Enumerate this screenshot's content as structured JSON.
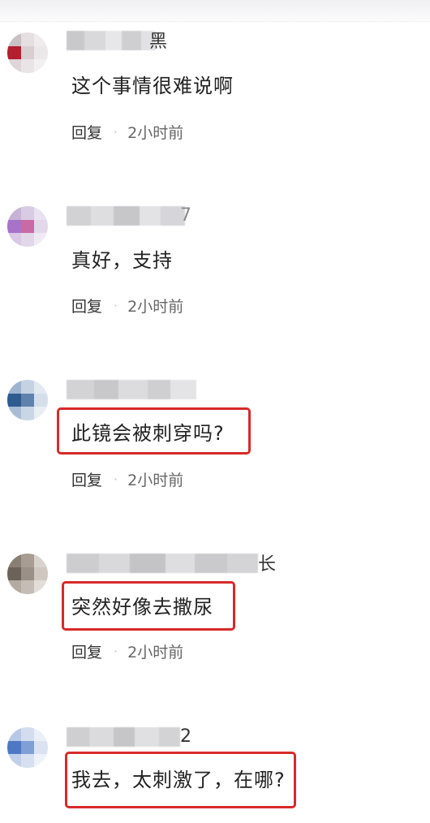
{
  "comments": [
    {
      "name_tail": "黑",
      "text": "这个事情很难说啊",
      "reply": "回复",
      "dot": "·",
      "time": "2小时前"
    },
    {
      "name_tail": "7",
      "text": "真好，支持",
      "reply": "回复",
      "dot": "·",
      "time": "2小时前"
    },
    {
      "name_tail": "",
      "text": "此镜会被刺穿吗?",
      "reply": "回复",
      "dot": "·",
      "time": "2小时前"
    },
    {
      "name_tail": "长",
      "text": "突然好像去撒尿",
      "reply": "回复",
      "dot": "·",
      "time": "2小时前"
    },
    {
      "name_tail": "2",
      "text": "我去，太刺激了，在哪?"
    }
  ],
  "colors": {
    "highlight": "#d72a2a",
    "meta_gray": "#666666"
  }
}
